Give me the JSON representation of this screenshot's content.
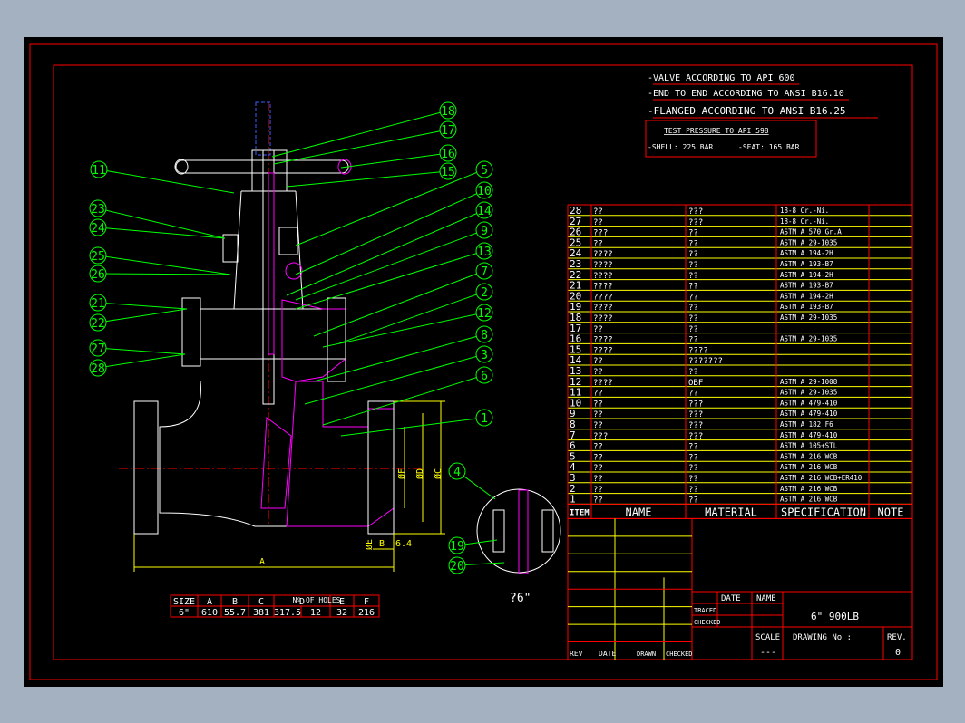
{
  "notes": {
    "valve": "-VALVE ACCORDING TO API 600",
    "end_to_end": "-END TO END ACCORDING TO ANSI B16.10",
    "flanged": "-FLANGED ACCORDING TO ANSI B16.25",
    "test_pressure": "TEST PRESSURE TO API 598",
    "shell": "-SHELL: 225 BAR",
    "seat": "-SEAT: 165 BAR"
  },
  "balloons_left": [
    "11",
    "23",
    "24",
    "25",
    "26",
    "21",
    "22",
    "27",
    "28"
  ],
  "balloons_right": [
    "18",
    "17",
    "16",
    "15",
    "5",
    "10",
    "14",
    "9",
    "13",
    "7",
    "2",
    "12",
    "8",
    "3",
    "6",
    "1"
  ],
  "balloons_detail": [
    "4",
    "19",
    "20"
  ],
  "dimensions": {
    "a": "A",
    "b": "B",
    "b_val": "6.4",
    "c": "ØC",
    "d": "ØD",
    "e": "ØE",
    "f": "ØF"
  },
  "size_table": {
    "headers": [
      "SIZE",
      "A",
      "B",
      "C",
      "D",
      "E",
      "F"
    ],
    "header_overlay": "Nº OF HOLES",
    "row": [
      "6\"",
      "610",
      "55.7",
      "381",
      "317.5",
      "12",
      "32",
      "216"
    ]
  },
  "size_label": "?6\"",
  "bom": {
    "rows": [
      {
        "item": "28",
        "name": "??",
        "material": "???",
        "spec": "18-8 Cr.-Ni."
      },
      {
        "item": "27",
        "name": "??",
        "material": "???",
        "spec": "18-8 Cr.-Ni."
      },
      {
        "item": "26",
        "name": "???",
        "material": "??",
        "spec": "ASTM A 570 Gr.A"
      },
      {
        "item": "25",
        "name": "??",
        "material": "??",
        "spec": "ASTM A 29-1035"
      },
      {
        "item": "24",
        "name": "????",
        "material": "??",
        "spec": "ASTM A 194-2H"
      },
      {
        "item": "23",
        "name": "????",
        "material": "??",
        "spec": "ASTM A 193-B7"
      },
      {
        "item": "22",
        "name": "????",
        "material": "??",
        "spec": "ASTM A 194-2H"
      },
      {
        "item": "21",
        "name": "????",
        "material": "??",
        "spec": "ASTM A 193-B7"
      },
      {
        "item": "20",
        "name": "????",
        "material": "??",
        "spec": "ASTM A 194-2H"
      },
      {
        "item": "19",
        "name": "????",
        "material": "??",
        "spec": "ASTM A 193-B7"
      },
      {
        "item": "18",
        "name": "????",
        "material": "??",
        "spec": "ASTM A 29-1035"
      },
      {
        "item": "17",
        "name": "??",
        "material": "??",
        "spec": ""
      },
      {
        "item": "16",
        "name": "????",
        "material": "??",
        "spec": "ASTM A 29-1035"
      },
      {
        "item": "15",
        "name": "????",
        "material": "????",
        "spec": ""
      },
      {
        "item": "14",
        "name": "??",
        "material": "???????",
        "spec": ""
      },
      {
        "item": "13",
        "name": "??",
        "material": "??",
        "spec": ""
      },
      {
        "item": "12",
        "name": "????",
        "material": "OBF",
        "spec": "ASTM A 29-1008"
      },
      {
        "item": "11",
        "name": "??",
        "material": "??",
        "spec": "ASTM A 29-1035"
      },
      {
        "item": "10",
        "name": "??",
        "material": "???",
        "spec": "ASTM A 479-410"
      },
      {
        "item": "9",
        "name": "??",
        "material": "???",
        "spec": "ASTM A 479-410"
      },
      {
        "item": "8",
        "name": "??",
        "material": "???",
        "spec": "ASTM A 182 F6"
      },
      {
        "item": "7",
        "name": "???",
        "material": "???",
        "spec": "ASTM A 479-410"
      },
      {
        "item": "6",
        "name": "??",
        "material": "??",
        "spec": "ASTM A 105+STL"
      },
      {
        "item": "5",
        "name": "??",
        "material": "??",
        "spec": "ASTM A 216 WCB"
      },
      {
        "item": "4",
        "name": "??",
        "material": "??",
        "spec": "ASTM A 216 WCB"
      },
      {
        "item": "3",
        "name": "??",
        "material": "??",
        "spec": "ASTM A 216 WCB+ER410"
      },
      {
        "item": "2",
        "name": "??",
        "material": "??",
        "spec": "ASTM A 216 WCB"
      },
      {
        "item": "1",
        "name": "??",
        "material": "??",
        "spec": "ASTM A 216 WCB"
      }
    ],
    "headers": {
      "item": "ITEM",
      "name": "NAME",
      "material": "MATERIAL",
      "spec": "SPECIFICATION",
      "note": "NOTE"
    }
  },
  "title_block": {
    "date": "DATE",
    "name": "NAME",
    "traced": "TRACED",
    "checked": "CHECKED",
    "title": "6\" 900LB",
    "scale": "SCALE",
    "scale_val": "---",
    "drawing_no": "DRAWING No :",
    "rev_label": "REV.",
    "rev_val": "0",
    "rev": "REV",
    "date2": "DATE",
    "drawn": "DRAWN",
    "checked2": "CHECKED"
  },
  "colors": {
    "background": "#000000",
    "frame": "#ff0000",
    "table": "#ffff00",
    "text": "#ffffff",
    "balloon": "#00ff00",
    "section": "#ff00ff",
    "dimension": "#ffff00"
  }
}
